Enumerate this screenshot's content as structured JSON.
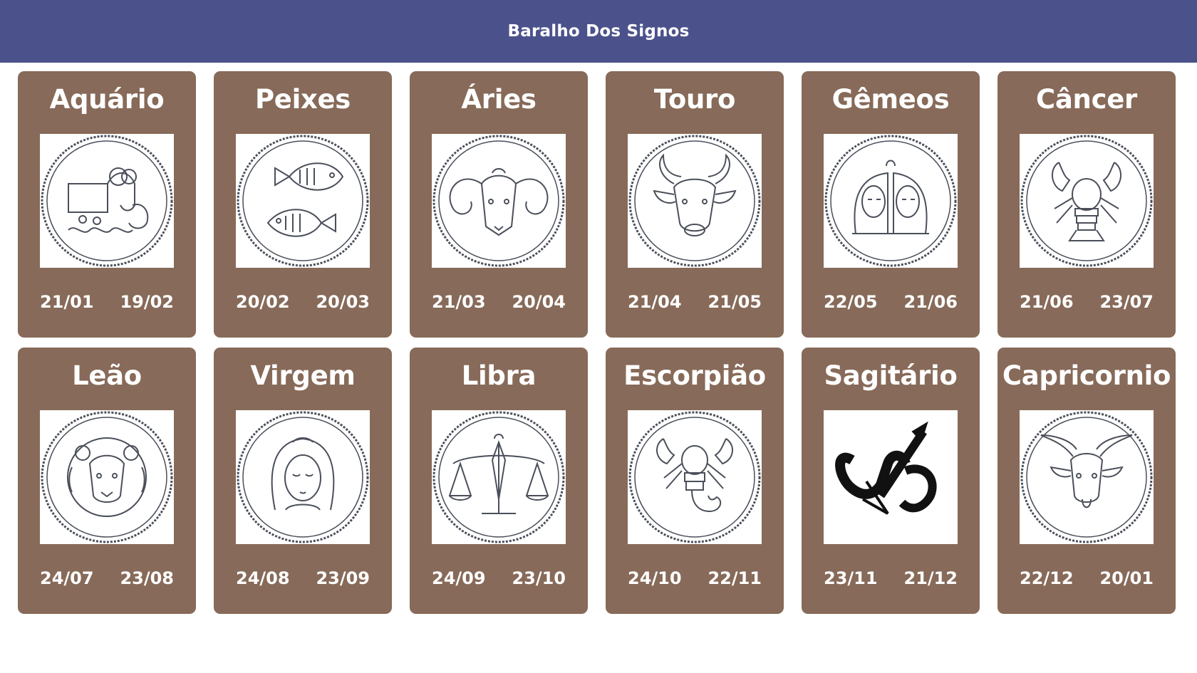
{
  "header": {
    "title": "Baralho Dos Signos"
  },
  "colors": {
    "header_bg": "#4b528b",
    "card_bg": "#876a59",
    "text": "#ffffff",
    "emblem_ink": "#4a4f5a"
  },
  "cards": [
    {
      "name": "Aquário",
      "start": "21/01",
      "end": "19/02",
      "icon": "aquarius-emblem-icon"
    },
    {
      "name": "Peixes",
      "start": "20/02",
      "end": "20/03",
      "icon": "pisces-emblem-icon"
    },
    {
      "name": "Áries",
      "start": "21/03",
      "end": "20/04",
      "icon": "aries-emblem-icon"
    },
    {
      "name": "Touro",
      "start": "21/04",
      "end": "21/05",
      "icon": "taurus-emblem-icon"
    },
    {
      "name": "Gêmeos",
      "start": "22/05",
      "end": "21/06",
      "icon": "gemini-emblem-icon"
    },
    {
      "name": "Câncer",
      "start": "21/06",
      "end": "23/07",
      "icon": "cancer-emblem-icon"
    },
    {
      "name": "Leão",
      "start": "24/07",
      "end": "23/08",
      "icon": "leo-emblem-icon"
    },
    {
      "name": "Virgem",
      "start": "24/08",
      "end": "23/09",
      "icon": "virgo-emblem-icon"
    },
    {
      "name": "Libra",
      "start": "24/09",
      "end": "23/10",
      "icon": "libra-emblem-icon"
    },
    {
      "name": "Escorpião",
      "start": "24/10",
      "end": "22/11",
      "icon": "scorpio-emblem-icon"
    },
    {
      "name": "Sagitário",
      "start": "23/11",
      "end": "21/12",
      "icon": "sagittarius-symbol-icon"
    },
    {
      "name": "Capricornio",
      "start": "22/12",
      "end": "20/01",
      "icon": "capricorn-emblem-icon"
    }
  ]
}
